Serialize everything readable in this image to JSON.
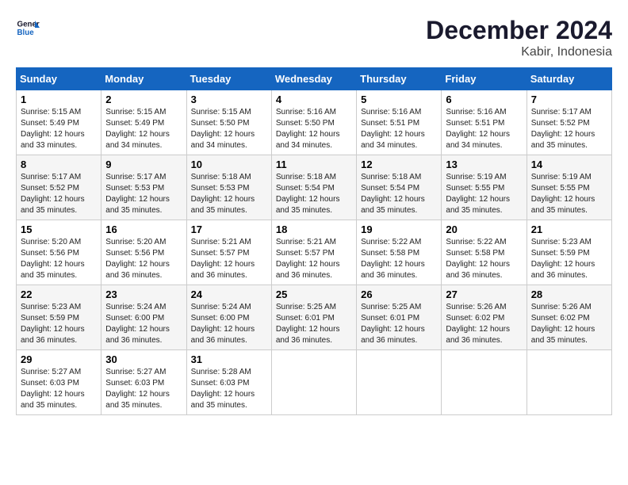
{
  "header": {
    "logo_line1": "General",
    "logo_line2": "Blue",
    "month_title": "December 2024",
    "location": "Kabir, Indonesia"
  },
  "weekdays": [
    "Sunday",
    "Monday",
    "Tuesday",
    "Wednesday",
    "Thursday",
    "Friday",
    "Saturday"
  ],
  "weeks": [
    [
      {
        "day": "1",
        "info": "Sunrise: 5:15 AM\nSunset: 5:49 PM\nDaylight: 12 hours\nand 33 minutes."
      },
      {
        "day": "2",
        "info": "Sunrise: 5:15 AM\nSunset: 5:49 PM\nDaylight: 12 hours\nand 34 minutes."
      },
      {
        "day": "3",
        "info": "Sunrise: 5:15 AM\nSunset: 5:50 PM\nDaylight: 12 hours\nand 34 minutes."
      },
      {
        "day": "4",
        "info": "Sunrise: 5:16 AM\nSunset: 5:50 PM\nDaylight: 12 hours\nand 34 minutes."
      },
      {
        "day": "5",
        "info": "Sunrise: 5:16 AM\nSunset: 5:51 PM\nDaylight: 12 hours\nand 34 minutes."
      },
      {
        "day": "6",
        "info": "Sunrise: 5:16 AM\nSunset: 5:51 PM\nDaylight: 12 hours\nand 34 minutes."
      },
      {
        "day": "7",
        "info": "Sunrise: 5:17 AM\nSunset: 5:52 PM\nDaylight: 12 hours\nand 35 minutes."
      }
    ],
    [
      {
        "day": "8",
        "info": "Sunrise: 5:17 AM\nSunset: 5:52 PM\nDaylight: 12 hours\nand 35 minutes."
      },
      {
        "day": "9",
        "info": "Sunrise: 5:17 AM\nSunset: 5:53 PM\nDaylight: 12 hours\nand 35 minutes."
      },
      {
        "day": "10",
        "info": "Sunrise: 5:18 AM\nSunset: 5:53 PM\nDaylight: 12 hours\nand 35 minutes."
      },
      {
        "day": "11",
        "info": "Sunrise: 5:18 AM\nSunset: 5:54 PM\nDaylight: 12 hours\nand 35 minutes."
      },
      {
        "day": "12",
        "info": "Sunrise: 5:18 AM\nSunset: 5:54 PM\nDaylight: 12 hours\nand 35 minutes."
      },
      {
        "day": "13",
        "info": "Sunrise: 5:19 AM\nSunset: 5:55 PM\nDaylight: 12 hours\nand 35 minutes."
      },
      {
        "day": "14",
        "info": "Sunrise: 5:19 AM\nSunset: 5:55 PM\nDaylight: 12 hours\nand 35 minutes."
      }
    ],
    [
      {
        "day": "15",
        "info": "Sunrise: 5:20 AM\nSunset: 5:56 PM\nDaylight: 12 hours\nand 35 minutes."
      },
      {
        "day": "16",
        "info": "Sunrise: 5:20 AM\nSunset: 5:56 PM\nDaylight: 12 hours\nand 36 minutes."
      },
      {
        "day": "17",
        "info": "Sunrise: 5:21 AM\nSunset: 5:57 PM\nDaylight: 12 hours\nand 36 minutes."
      },
      {
        "day": "18",
        "info": "Sunrise: 5:21 AM\nSunset: 5:57 PM\nDaylight: 12 hours\nand 36 minutes."
      },
      {
        "day": "19",
        "info": "Sunrise: 5:22 AM\nSunset: 5:58 PM\nDaylight: 12 hours\nand 36 minutes."
      },
      {
        "day": "20",
        "info": "Sunrise: 5:22 AM\nSunset: 5:58 PM\nDaylight: 12 hours\nand 36 minutes."
      },
      {
        "day": "21",
        "info": "Sunrise: 5:23 AM\nSunset: 5:59 PM\nDaylight: 12 hours\nand 36 minutes."
      }
    ],
    [
      {
        "day": "22",
        "info": "Sunrise: 5:23 AM\nSunset: 5:59 PM\nDaylight: 12 hours\nand 36 minutes."
      },
      {
        "day": "23",
        "info": "Sunrise: 5:24 AM\nSunset: 6:00 PM\nDaylight: 12 hours\nand 36 minutes."
      },
      {
        "day": "24",
        "info": "Sunrise: 5:24 AM\nSunset: 6:00 PM\nDaylight: 12 hours\nand 36 minutes."
      },
      {
        "day": "25",
        "info": "Sunrise: 5:25 AM\nSunset: 6:01 PM\nDaylight: 12 hours\nand 36 minutes."
      },
      {
        "day": "26",
        "info": "Sunrise: 5:25 AM\nSunset: 6:01 PM\nDaylight: 12 hours\nand 36 minutes."
      },
      {
        "day": "27",
        "info": "Sunrise: 5:26 AM\nSunset: 6:02 PM\nDaylight: 12 hours\nand 36 minutes."
      },
      {
        "day": "28",
        "info": "Sunrise: 5:26 AM\nSunset: 6:02 PM\nDaylight: 12 hours\nand 35 minutes."
      }
    ],
    [
      {
        "day": "29",
        "info": "Sunrise: 5:27 AM\nSunset: 6:03 PM\nDaylight: 12 hours\nand 35 minutes."
      },
      {
        "day": "30",
        "info": "Sunrise: 5:27 AM\nSunset: 6:03 PM\nDaylight: 12 hours\nand 35 minutes."
      },
      {
        "day": "31",
        "info": "Sunrise: 5:28 AM\nSunset: 6:03 PM\nDaylight: 12 hours\nand 35 minutes."
      },
      null,
      null,
      null,
      null
    ]
  ]
}
